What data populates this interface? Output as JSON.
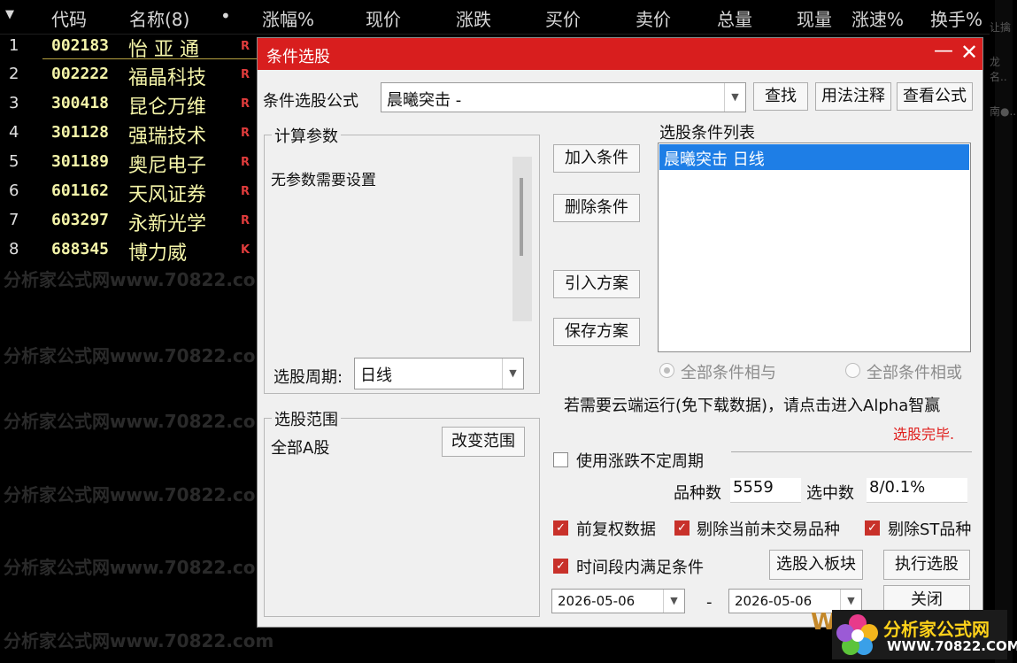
{
  "header": {
    "index_col": "▼",
    "code_col": "代码",
    "name_col": "名称(8)",
    "dot_col": "•",
    "change_pct_col": "涨幅%",
    "price_col": "现价",
    "change_col": "涨跌",
    "bid_col": "买价",
    "ask_col": "卖价",
    "volume_col": "总量",
    "cur_volume_col": "现量",
    "speed_col": "涨速%",
    "turnover_col": "换手%"
  },
  "stocks": [
    {
      "idx": "1",
      "code": "002183",
      "name": "怡 亚 通",
      "flag": "R"
    },
    {
      "idx": "2",
      "code": "002222",
      "name": "福晶科技",
      "flag": "R"
    },
    {
      "idx": "3",
      "code": "300418",
      "name": "昆仑万维",
      "flag": "R"
    },
    {
      "idx": "4",
      "code": "301128",
      "name": "强瑞技术",
      "flag": "R"
    },
    {
      "idx": "5",
      "code": "301189",
      "name": "奥尼电子",
      "flag": "R"
    },
    {
      "idx": "6",
      "code": "601162",
      "name": "天风证券",
      "flag": "R"
    },
    {
      "idx": "7",
      "code": "603297",
      "name": "永新光学",
      "flag": "R"
    },
    {
      "idx": "8",
      "code": "688345",
      "name": "博力威",
      "flag": "K"
    }
  ],
  "right_fragments": [
    "让擒",
    "龙名..",
    "南●.."
  ],
  "watermark": "分析家公式网www.70822.com",
  "dialog": {
    "title": "条件选股",
    "minimize": "—",
    "close": "✕",
    "formula_label": "条件选股公式",
    "formula_value": "晨曦突击  -",
    "find_button": "查找",
    "usage_button": "用法注释",
    "view_formula_button": "查看公式",
    "params_group": "计算参数",
    "params_text": "无参数需要设置",
    "period_label": "选股周期:",
    "period_value": "日线",
    "add_condition": "加入条件",
    "delete_condition": "删除条件",
    "import_scheme": "引入方案",
    "save_scheme": "保存方案",
    "conditions_list_label": "选股条件列表",
    "conditions": [
      "晨曦突击  日线"
    ],
    "radio_and": "全部条件相与",
    "radio_or": "全部条件相或",
    "cloud_text": "若需要云端运行(免下载数据)，请点击进入Alpha智赢",
    "status_text": "选股完毕.",
    "scope_group": "选股范围",
    "scope_value": "全部A股",
    "change_scope": "改变范围",
    "use_variable_period": "使用涨跌不定周期",
    "variety_count_label": "品种数",
    "variety_count": "5559",
    "selected_count_label": "选中数",
    "selected_count": "8/0.1%",
    "adjusted_data": "前复权数据",
    "exclude_untraded": "剔除当前未交易品种",
    "exclude_st": "剔除ST品种",
    "time_range_satisfy": "时间段内满足条件",
    "add_to_block": "选股入板块",
    "execute_button": "执行选股",
    "date_from": "2026-05-06",
    "date_sep": "-",
    "date_to": "2026-05-06",
    "close_button": "关闭"
  },
  "logo": {
    "line1": "分析家公式网",
    "line2": "WWW.70822.COM",
    "partial": "W"
  }
}
